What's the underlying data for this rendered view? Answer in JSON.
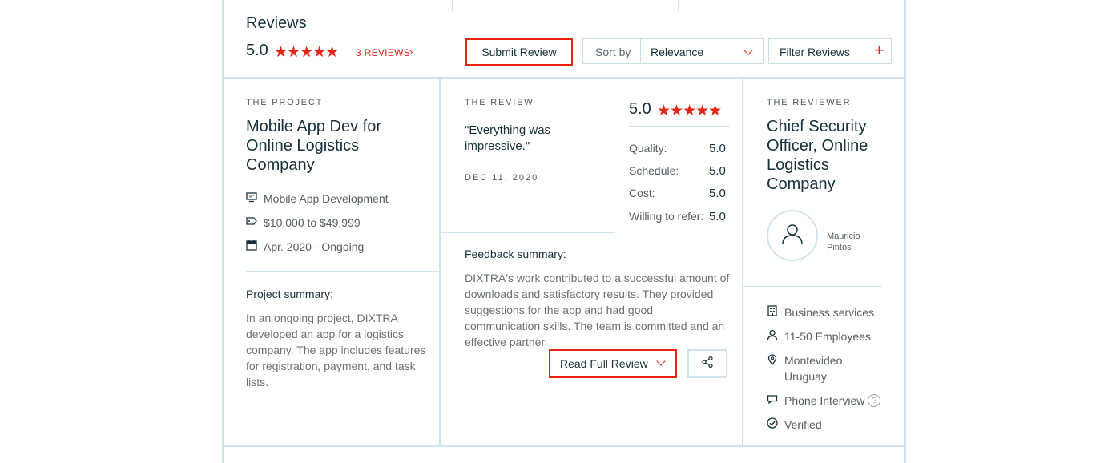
{
  "header": {
    "title": "Reviews",
    "overall_score": "5.0",
    "stars": "★★★★★",
    "review_count_label": "3 REVIEWS",
    "review_count_chevron": "›",
    "submit_label": "Submit Review",
    "sort_label": "Sort by",
    "sort_value": "Relevance",
    "filter_label": "Filter Reviews",
    "filter_plus": "+"
  },
  "project": {
    "eyebrow": "THE PROJECT",
    "title": "Mobile App Dev for Online Logistics Company",
    "service": "Mobile App Development",
    "budget": "$10,000 to $49,999",
    "timeline": "Apr. 2020 - Ongoing",
    "summary_label": "Project summary:",
    "summary": "In an ongoing project, DIXTRA developed an app for a logistics company. The app includes features for registration, payment, and task lists."
  },
  "review": {
    "eyebrow": "THE REVIEW",
    "quote": "\"Everything was impressive.\"",
    "date": "DEC 11, 2020",
    "score": "5.0",
    "stars": "★★★★★",
    "ratings": [
      {
        "label": "Quality:",
        "value": "5.0"
      },
      {
        "label": "Schedule:",
        "value": "5.0"
      },
      {
        "label": "Cost:",
        "value": "5.0"
      },
      {
        "label": "Willing to refer:",
        "value": "5.0"
      }
    ],
    "feedback_label": "Feedback summary:",
    "feedback": "DIXTRA's work contributed to a successful amount of downloads and satisfactory results. They provided suggestions for the app and had good communication skills. The team is committed and an effective partner.",
    "read_full_label": "Read Full Review"
  },
  "reviewer": {
    "eyebrow": "THE REVIEWER",
    "title": "Chief Security Officer, Online Logistics Company",
    "name": "Mauricio Pintos",
    "industry": "Business services",
    "employees": "11-50 Employees",
    "location": "Montevideo, Uruguay",
    "interview": "Phone Interview",
    "help": "?",
    "verified": "Verified"
  },
  "colors": {
    "accent": "#e62415",
    "border": "#cfe4ea",
    "heading": "#17313b"
  }
}
